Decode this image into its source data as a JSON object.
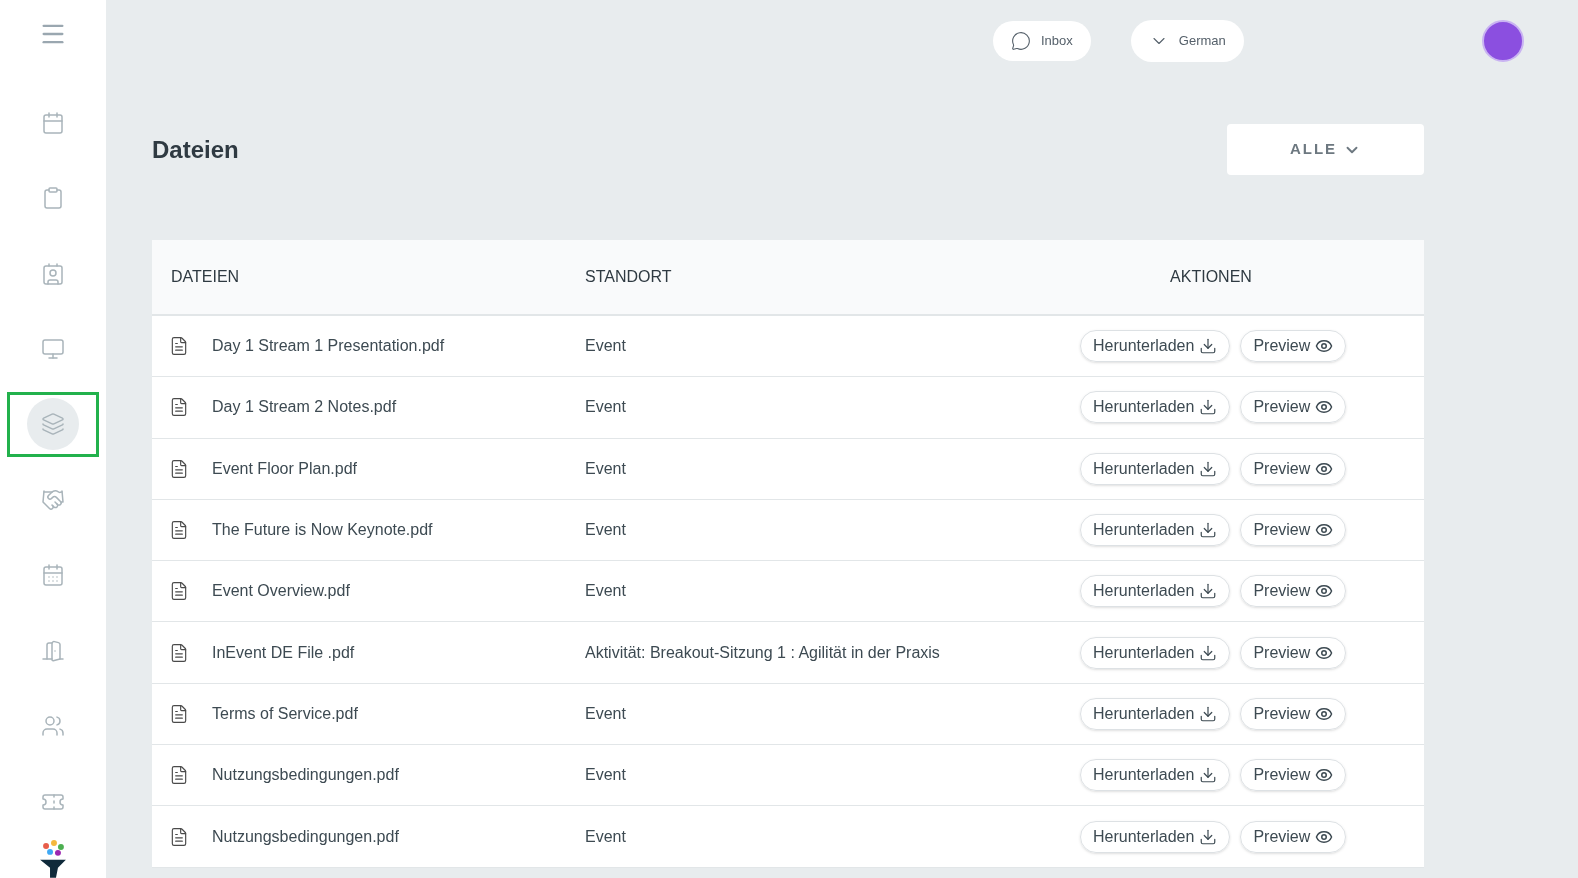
{
  "sidebar": {
    "items": [
      {
        "selected": false
      },
      {
        "selected": false
      },
      {
        "selected": false
      },
      {
        "selected": false
      },
      {
        "selected": true
      },
      {
        "selected": false
      },
      {
        "selected": false
      },
      {
        "selected": false
      },
      {
        "selected": false
      },
      {
        "selected": false
      }
    ]
  },
  "topbar": {
    "inbox": "Inbox",
    "language": "German"
  },
  "page": {
    "title": "Dateien",
    "filter": "ALLE"
  },
  "table": {
    "columns": [
      "DATEIEN",
      "STANDORT",
      "AKTIONEN"
    ],
    "rows": [
      {
        "file": "Day 1 Stream 1 Presentation.pdf",
        "location": "Event",
        "download": "Herunterladen",
        "preview": "Preview"
      },
      {
        "file": "Day 1 Stream 2 Notes.pdf",
        "location": "Event",
        "download": "Herunterladen",
        "preview": "Preview"
      },
      {
        "file": "Event Floor Plan.pdf",
        "location": "Event",
        "download": "Herunterladen",
        "preview": "Preview"
      },
      {
        "file": "The Future is Now Keynote.pdf",
        "location": "Event",
        "download": "Herunterladen",
        "preview": "Preview"
      },
      {
        "file": "Event Overview.pdf",
        "location": "Event",
        "download": "Herunterladen",
        "preview": "Preview"
      },
      {
        "file": "InEvent DE File .pdf",
        "location": "Aktivität: Breakout-Sitzung 1 : Agilität in der Praxis",
        "download": "Herunterladen",
        "preview": "Preview"
      },
      {
        "file": "Terms of Service.pdf",
        "location": "Event",
        "download": "Herunterladen",
        "preview": "Preview"
      },
      {
        "file": "Nutzungsbedingungen.pdf",
        "location": "Event",
        "download": "Herunterladen",
        "preview": "Preview"
      },
      {
        "file": "Nutzungsbedingungen.pdf",
        "location": "Event",
        "download": "Herunterladen",
        "preview": "Preview"
      }
    ]
  }
}
